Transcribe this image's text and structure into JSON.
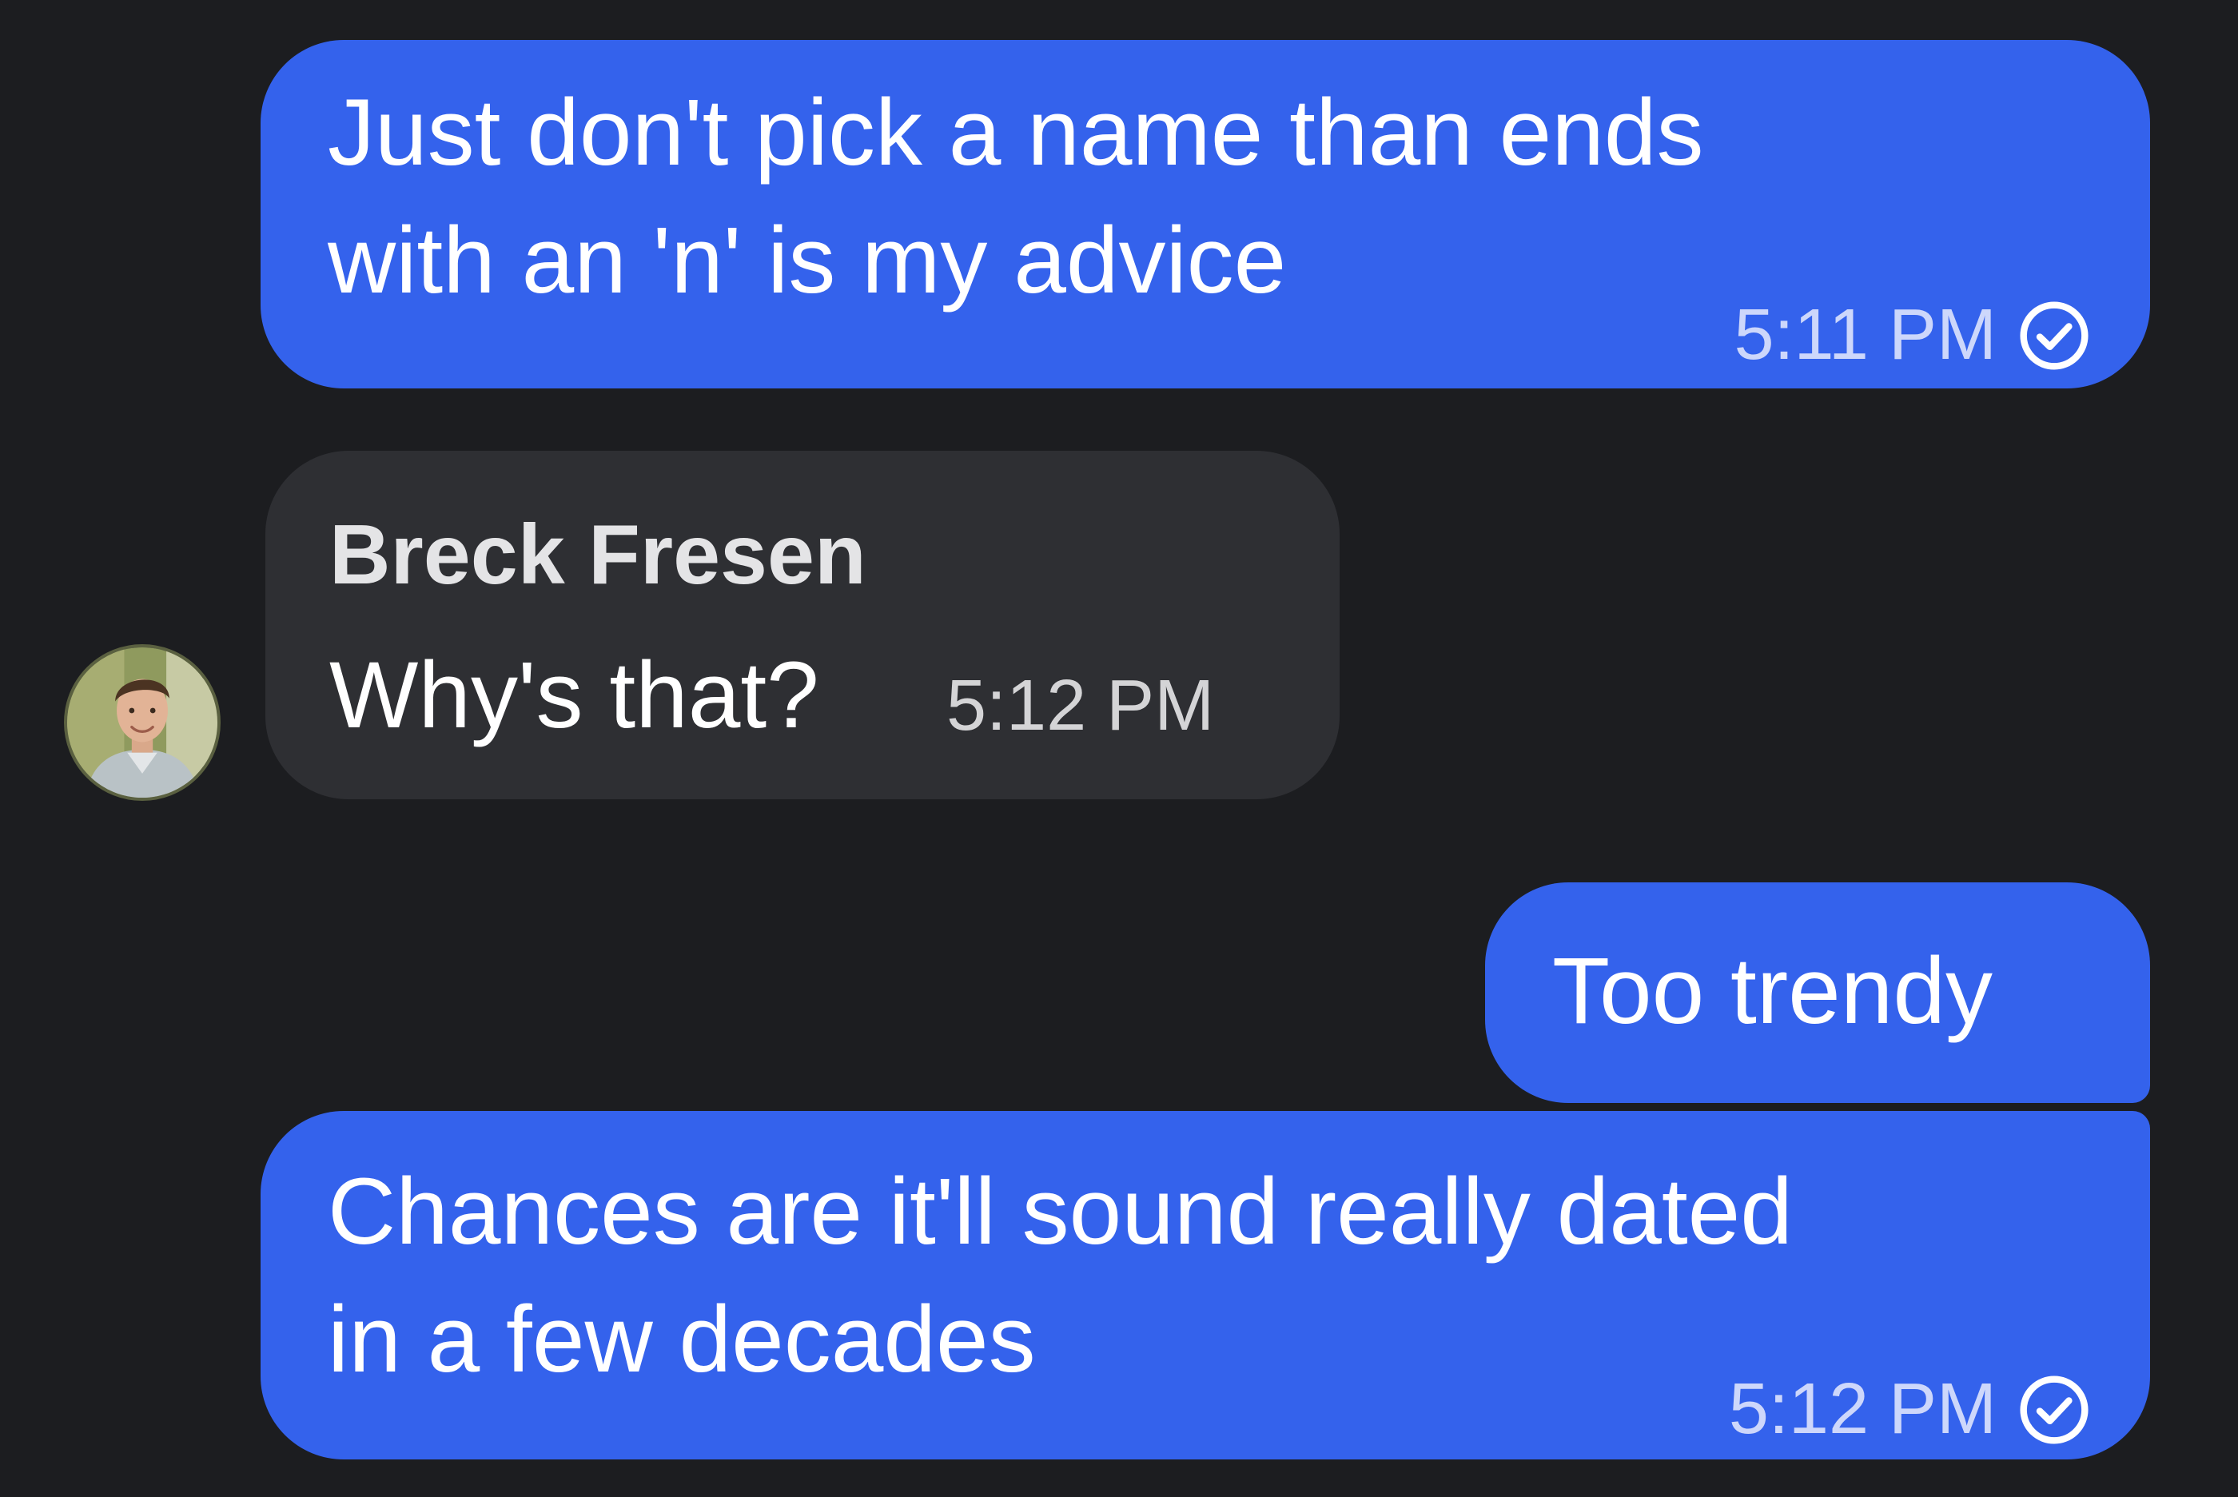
{
  "messages": [
    {
      "direction": "outgoing",
      "lines": [
        "Just don't pick a name than ends",
        "with an 'n' is my advice"
      ],
      "time": "5:11 PM",
      "status_icon": "read-check-icon"
    },
    {
      "direction": "incoming",
      "sender": "Breck Fresen",
      "text": "Why's that?",
      "time": "5:12 PM",
      "avatar_icon": "avatar-photo"
    },
    {
      "direction": "outgoing",
      "text": "Too trendy"
    },
    {
      "direction": "outgoing",
      "lines": [
        "Chances are it'll sound really dated",
        "in a few decades"
      ],
      "time": "5:12 PM",
      "status_icon": "read-check-icon"
    }
  ],
  "colors": {
    "background": "#1c1d20",
    "outgoing_bubble": "#3462ec",
    "incoming_bubble": "#2e2f33",
    "text": "#ffffff"
  }
}
